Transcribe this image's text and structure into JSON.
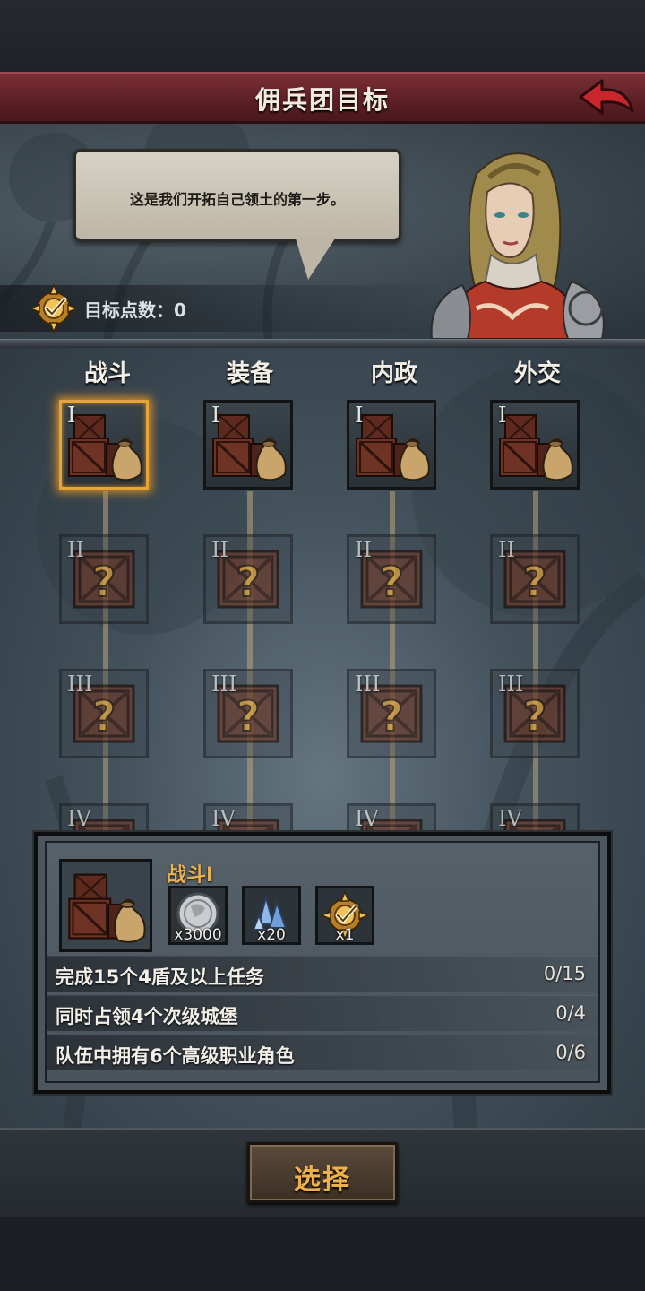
{
  "header": {
    "title": "佣兵团目标",
    "back_icon": "back-arrow-icon"
  },
  "dialogue": {
    "text": "这是我们开拓自己领土的第一步。"
  },
  "points": {
    "label": "目标点数：0"
  },
  "columns": [
    {
      "title": "战斗"
    },
    {
      "title": "装备"
    },
    {
      "title": "内政"
    },
    {
      "title": "外交"
    }
  ],
  "tiers": [
    "I",
    "II",
    "III",
    "IV"
  ],
  "detail": {
    "title": "战斗I",
    "rewards": [
      {
        "icon": "silver-coin-icon",
        "qty": "x3000"
      },
      {
        "icon": "crystal-icon",
        "qty": "x20"
      },
      {
        "icon": "target-badge-icon",
        "qty": "x1"
      }
    ],
    "tasks": [
      {
        "text": "完成15个4盾及以上任务",
        "progress": "0/15"
      },
      {
        "text": "同时占领4个次级城堡",
        "progress": "0/4"
      },
      {
        "text": "队伍中拥有6个高级职业角色",
        "progress": "0/6"
      }
    ]
  },
  "actions": {
    "select_label": "选择"
  },
  "colors": {
    "banner": "#6a262c",
    "accent_gold": "#e9b14f",
    "selected_glow": "#e6a53a"
  }
}
